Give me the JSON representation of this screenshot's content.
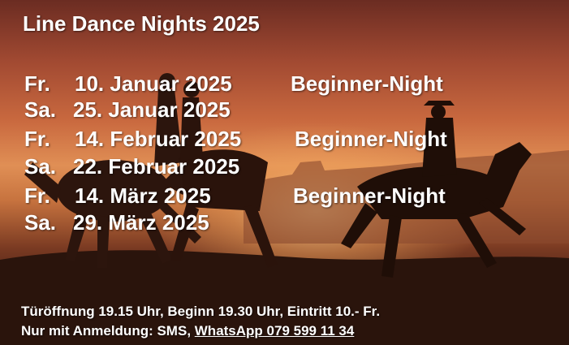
{
  "title": "Line Dance Nights 2025",
  "events": [
    {
      "day": "Fr.",
      "date": "10. Januar 2025",
      "label": "Beginner-Night"
    },
    {
      "day": "Sa.",
      "date": "25. Januar 2025",
      "label": ""
    },
    {
      "day": "Fr.",
      "date": "14. Februar 2025",
      "label": "Beginner-Night"
    },
    {
      "day": "Sa.",
      "date": "22. Februar 2025",
      "label": ""
    },
    {
      "day": "Fr.",
      "date": "14. März 2025",
      "label": "Beginner-Night"
    },
    {
      "day": "Sa.",
      "date": "29. März 2025",
      "label": ""
    }
  ],
  "footer": {
    "line1": "Türöffnung 19.15 Uhr, Beginn 19.30 Uhr, Eintritt 10.- Fr.",
    "line2_prefix": "Nur mit Anmeldung: ",
    "sms": "SMS",
    "separator": ", ",
    "whatsapp": "WhatsApp  079 599 11 34"
  },
  "colors": {
    "text": "#ffffff",
    "sky_top": "#6b2c22",
    "glow": "#e08f55",
    "ground": "#24120c"
  }
}
